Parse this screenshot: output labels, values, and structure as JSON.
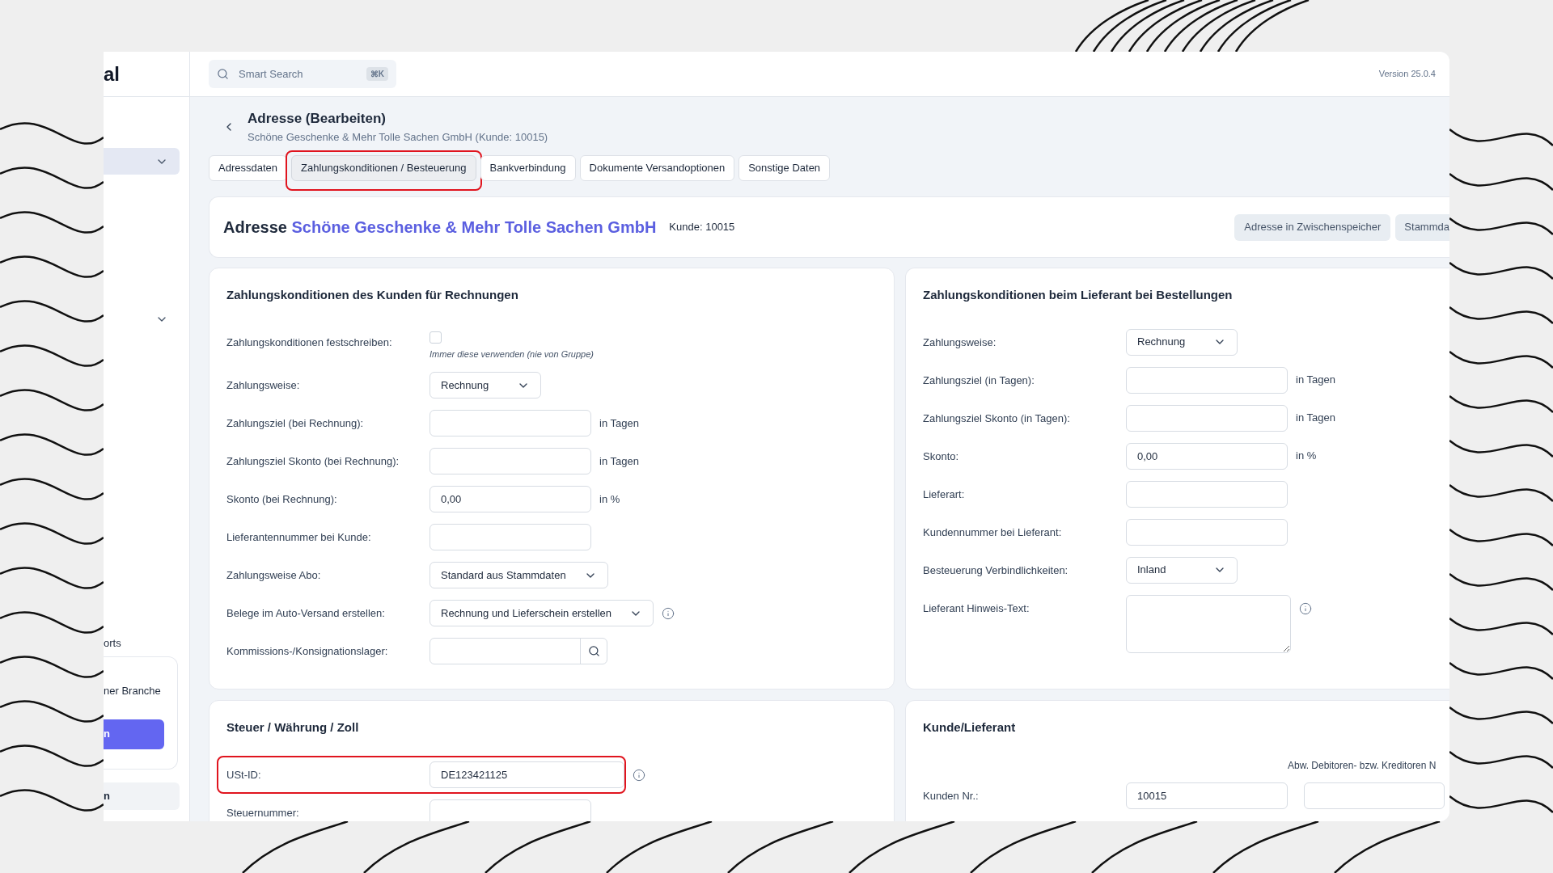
{
  "sidebar": {
    "logo": "al",
    "groups": [
      {
        "kind": "collapsible",
        "selected": true
      },
      {
        "kind": "collapsible",
        "selected": false
      }
    ],
    "section_label": "orts",
    "promo_card": {
      "text": "ner Branche",
      "button": "n"
    },
    "bottom_item": "n"
  },
  "top_bar": {
    "search": {
      "placeholder": "Smart Search",
      "shortcut": "⌘K"
    },
    "version": "Version 25.0.4"
  },
  "header": {
    "title": "Adresse (Bearbeiten)",
    "subtitle": "Schöne Geschenke & Mehr Tolle Sachen GmbH (Kunde: 10015)"
  },
  "tabs": [
    {
      "label": "Adressdaten",
      "selected": false,
      "highlighted": false
    },
    {
      "label": "Zahlungskonditionen / Besteuerung",
      "selected": true,
      "highlighted": true
    },
    {
      "label": "Bankverbindung",
      "selected": false,
      "highlighted": false
    },
    {
      "label": "Dokumente Versandoptionen",
      "selected": false,
      "highlighted": false
    },
    {
      "label": "Sonstige Daten",
      "selected": false,
      "highlighted": false
    }
  ],
  "address_card": {
    "prefix": "Adresse",
    "name": "Schöne Geschenke & Mehr Tolle Sachen GmbH",
    "customer": "Kunde: 10015",
    "buttons": [
      "Adresse in Zwischenspeicher",
      "Stammda"
    ]
  },
  "panels": [
    {
      "title": "Zahlungskonditionen des Kunden für Rechnungen",
      "fields": [
        {
          "label": "Zahlungskonditionen festschreiben:",
          "kind": "checkbox",
          "checked": false,
          "note": "Immer diese verwenden (nie von Gruppe)"
        },
        {
          "label": "Zahlungsweise:",
          "kind": "select",
          "value": "Rechnung"
        },
        {
          "label": "Zahlungsziel (bei Rechnung):",
          "kind": "input",
          "unit": "in Tagen"
        },
        {
          "label": "Zahlungsziel Skonto (bei Rechnung):",
          "kind": "input",
          "unit": "in Tagen"
        },
        {
          "label": "Skonto (bei Rechnung):",
          "kind": "input",
          "value": "0,00",
          "unit": "in %"
        },
        {
          "label": "Lieferantennummer bei Kunde:",
          "kind": "input"
        },
        {
          "label": "Zahlungsweise Abo:",
          "kind": "select",
          "value": "Standard aus Stammdaten"
        },
        {
          "label": "Belege im Auto-Versand erstellen:",
          "kind": "select",
          "value": "Rechnung und Lieferschein erstellen",
          "info": true
        },
        {
          "label": "Kommissions-/Konsignationslager:",
          "kind": "search"
        }
      ]
    },
    {
      "title": "Zahlungskonditionen beim Lieferant bei Bestellungen",
      "fields": [
        {
          "label": "Zahlungsweise:",
          "kind": "select",
          "value": "Rechnung"
        },
        {
          "label": "Zahlungsziel (in Tagen):",
          "kind": "input",
          "unit": "in Tagen"
        },
        {
          "label": "Zahlungsziel Skonto (in Tagen):",
          "kind": "input",
          "unit": "in Tagen"
        },
        {
          "label": "Skonto:",
          "kind": "input",
          "value": "0,00",
          "unit": "in %"
        },
        {
          "label": "Lieferart:",
          "kind": "input"
        },
        {
          "label": "Kundennummer bei Lieferant:",
          "kind": "input"
        },
        {
          "label": "Besteuerung Verbindlichkeiten:",
          "kind": "select",
          "value": "Inland"
        },
        {
          "label": "Lieferant Hinweis-Text:",
          "kind": "textarea",
          "info": true
        }
      ]
    },
    {
      "title": "Steuer / Währung / Zoll",
      "fields": [
        {
          "label": "USt-ID:",
          "kind": "input",
          "value": "DE123421125",
          "info": true,
          "highlighted": true
        },
        {
          "label": "Steuernummer:",
          "kind": "input"
        }
      ]
    },
    {
      "title": "Kunde/Lieferant",
      "column_header": "Abw. Debitoren- bzw. Kreditoren N",
      "fields": [
        {
          "label": "Kunden Nr.:",
          "kind": "input_pair",
          "value": "10015"
        }
      ]
    }
  ]
}
